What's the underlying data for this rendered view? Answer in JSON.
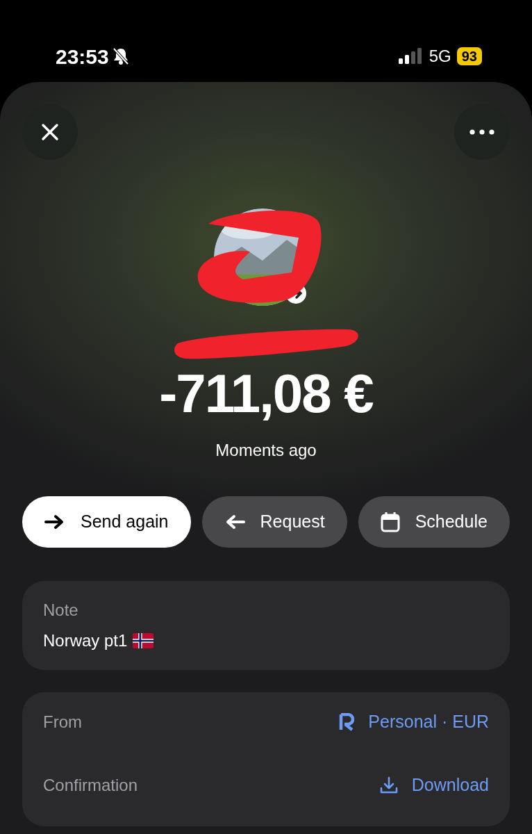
{
  "status_bar": {
    "time": "23:53",
    "silent": true,
    "network": "5G",
    "battery": "93"
  },
  "transaction": {
    "amount": "-711,08 €",
    "time": "Moments ago"
  },
  "actions": [
    {
      "label": "Send again",
      "kind": "send",
      "primary": true
    },
    {
      "label": "Request",
      "kind": "request",
      "primary": false
    },
    {
      "label": "Schedule",
      "kind": "schedule",
      "primary": false
    }
  ],
  "note": {
    "label": "Note",
    "value": "Norway pt1"
  },
  "details": [
    {
      "label": "From",
      "value": "Personal · EUR",
      "kind": "account"
    },
    {
      "label": "Confirmation",
      "value": "Download",
      "kind": "download"
    }
  ]
}
